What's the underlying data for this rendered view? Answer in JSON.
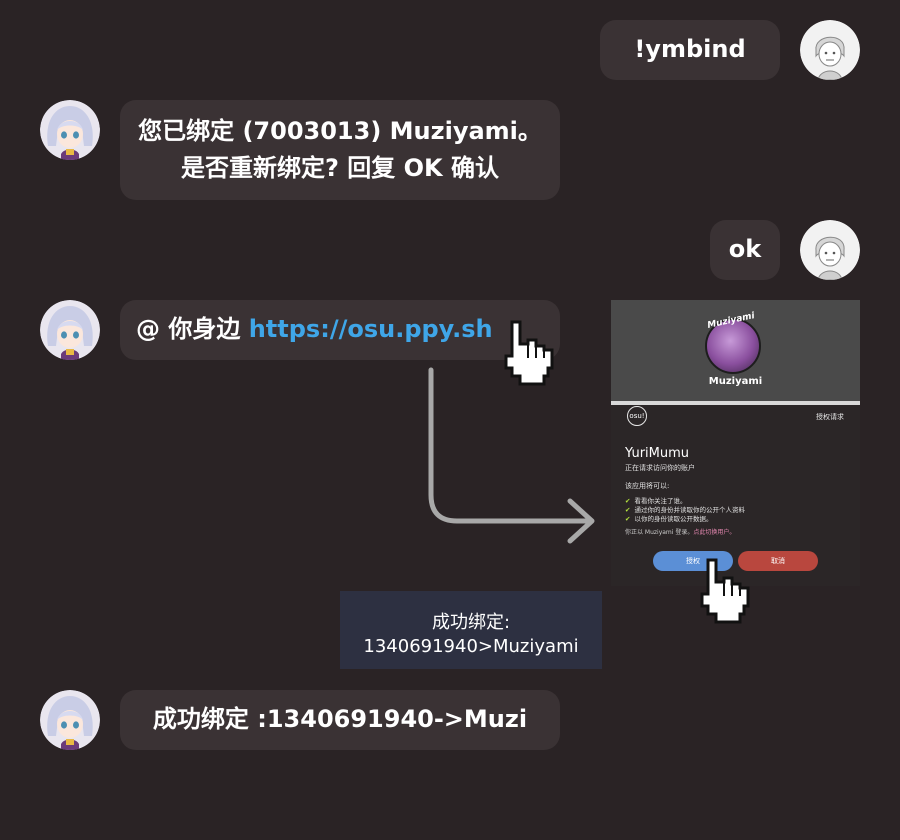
{
  "messages": [
    {
      "side": "right",
      "text": "!ymbind"
    },
    {
      "side": "left",
      "line1": "您已绑定 (7003013) Muziyami。",
      "line2": "是否重新绑定? 回复 OK 确认"
    },
    {
      "side": "right",
      "text": "ok"
    },
    {
      "side": "left",
      "prefix": "@ 你身边 ",
      "link": "https://osu.ppy.sh"
    },
    {
      "side": "left",
      "text": "成功绑定 :1340691940->Muzi"
    }
  ],
  "auth_screen": {
    "username": "Muziyami",
    "watermark": "Muziyami",
    "logo": "osu!",
    "header_right": "授权请求",
    "app_name": "YuriMumu",
    "app_subtitle": "正在请求访问你的账户",
    "permissions_title": "该应用将可以:",
    "permissions": [
      "看看你关注了谁。",
      "通过你的身份并读取你的公开个人资料",
      "以你的身份读取公开数据。"
    ],
    "login_note_prefix": "你正以 Muziyami 登录。",
    "login_note_link": "点此切换用户。",
    "authorize_label": "授权",
    "cancel_label": "取消"
  },
  "result_box": {
    "line1": "成功绑定:",
    "line2": "1340691940>Muziyami"
  },
  "colors": {
    "background": "#2a2325",
    "bubble": "#3a3234",
    "link": "#3fa6e8",
    "authorize": "#5b8fd6",
    "cancel": "#b9473e",
    "result_box": "#2d3041"
  },
  "icons": [
    "user-avatar-sketch-icon",
    "bot-avatar-anime-icon",
    "hand-pointer-icon",
    "curved-arrow-icon",
    "osu-logo-icon",
    "checkmark-icon"
  ]
}
